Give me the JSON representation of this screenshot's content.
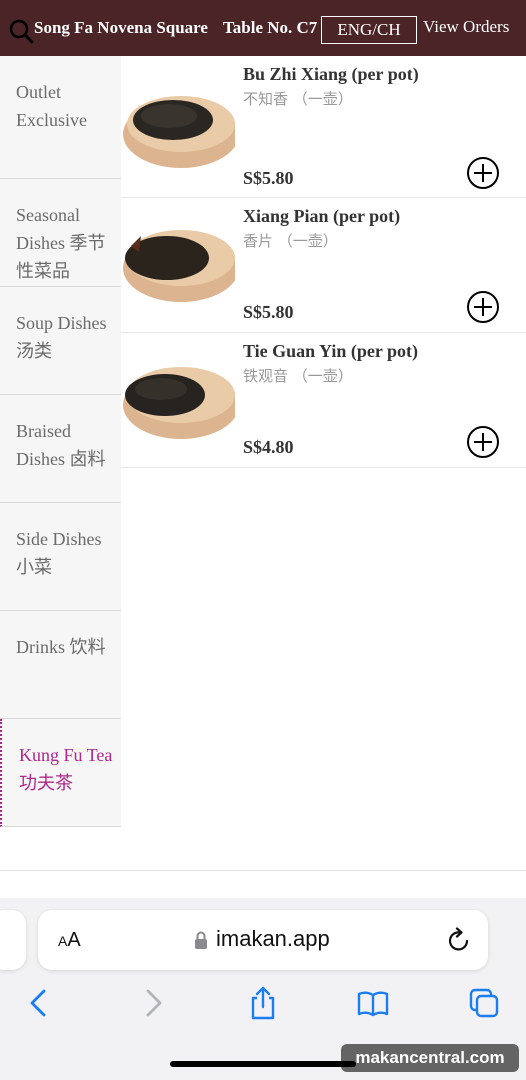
{
  "header": {
    "restaurant": "Song Fa Novena Square",
    "table": "Table No. C7",
    "lang_button": "ENG/CH",
    "view_orders": "View Orders"
  },
  "categories": [
    {
      "label": "Outlet Exclusive"
    },
    {
      "label": "Seasonal Dishes 季节性菜品"
    },
    {
      "label": "Soup Dishes 汤类"
    },
    {
      "label": "Braised Dishes 卤料"
    },
    {
      "label": "Side Dishes 小菜"
    },
    {
      "label": "Drinks 饮料"
    },
    {
      "label": "Kung Fu Tea 功夫茶"
    }
  ],
  "active_category": "Kung Fu Tea 功夫茶",
  "items": [
    {
      "name": "Bu Zhi Xiang (per pot)",
      "name_cn": "不知香 （一壶）",
      "price": "S$5.80"
    },
    {
      "name": "Xiang Pian (per pot)",
      "name_cn": "香片 （一壶）",
      "price": "S$5.80"
    },
    {
      "name": "Tie Guan Yin (per pot)",
      "name_cn": "铁观音 （一壶）",
      "price": "S$4.80"
    }
  ],
  "browser": {
    "text_size_label": "AA",
    "url": "imakan.app"
  },
  "watermark": "makancentral.com",
  "colors": {
    "header_bg": "#4a2426",
    "active_category": "#b0268a",
    "browser_icon": "#1a7df0"
  },
  "icons": [
    "search-icon",
    "add-icon",
    "lock-icon",
    "reload-icon",
    "back-icon",
    "forward-icon",
    "share-icon",
    "bookmarks-icon",
    "tabs-icon"
  ]
}
